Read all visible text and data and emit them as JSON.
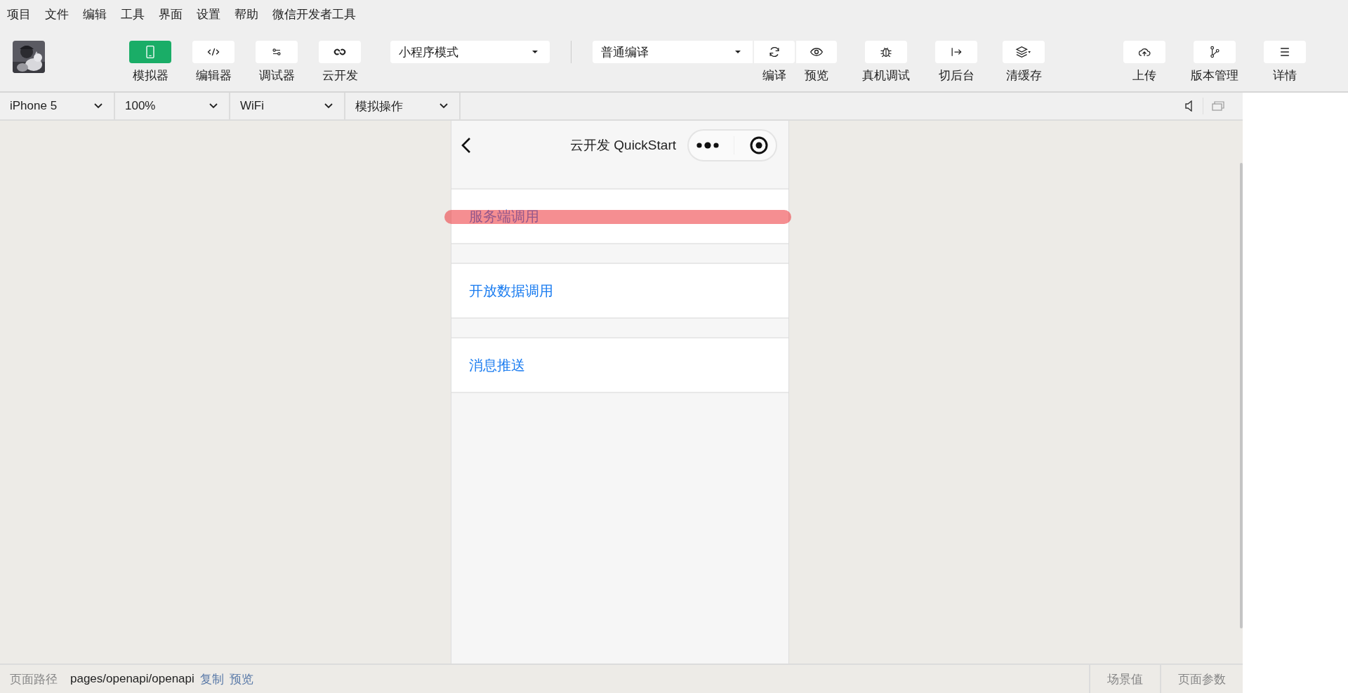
{
  "menu": [
    "项目",
    "文件",
    "编辑",
    "工具",
    "界面",
    "设置",
    "帮助",
    "微信开发者工具"
  ],
  "toolbar": {
    "views": [
      {
        "label": "模拟器",
        "kind": "phone",
        "selected": true
      },
      {
        "label": "编辑器",
        "kind": "code",
        "selected": false
      },
      {
        "label": "调试器",
        "kind": "sliders",
        "selected": false
      },
      {
        "label": "云开发",
        "kind": "cloud-link",
        "selected": false
      }
    ],
    "mode_select": {
      "value": "小程序模式"
    },
    "compile_select": {
      "value": "普通编译"
    },
    "compile_actions": [
      {
        "label": "编译",
        "kind": "refresh"
      },
      {
        "label": "预览",
        "kind": "eye"
      }
    ],
    "actions": [
      {
        "label": "真机调试",
        "kind": "bug"
      },
      {
        "label": "切后台",
        "kind": "switch"
      },
      {
        "label": "清缓存",
        "kind": "layers"
      }
    ],
    "right_actions": [
      {
        "label": "上传",
        "kind": "upload"
      },
      {
        "label": "版本管理",
        "kind": "branch"
      },
      {
        "label": "详情",
        "kind": "list"
      }
    ]
  },
  "device_bar": {
    "selects": [
      {
        "value": "iPhone 5"
      },
      {
        "value": "100%"
      },
      {
        "value": "WiFi"
      },
      {
        "value": "模拟操作"
      }
    ]
  },
  "simulator": {
    "nav_title": "云开发 QuickStart",
    "items": [
      {
        "label": "服务端调用",
        "highlighted": true
      },
      {
        "label": "开放数据调用",
        "highlighted": false
      },
      {
        "label": "消息推送",
        "highlighted": false
      }
    ]
  },
  "status_bar": {
    "path_label": "页面路径",
    "path": "pages/openapi/openapi",
    "links": [
      "复制",
      "预览"
    ],
    "tabs": [
      "场景值",
      "页面参数"
    ]
  }
}
